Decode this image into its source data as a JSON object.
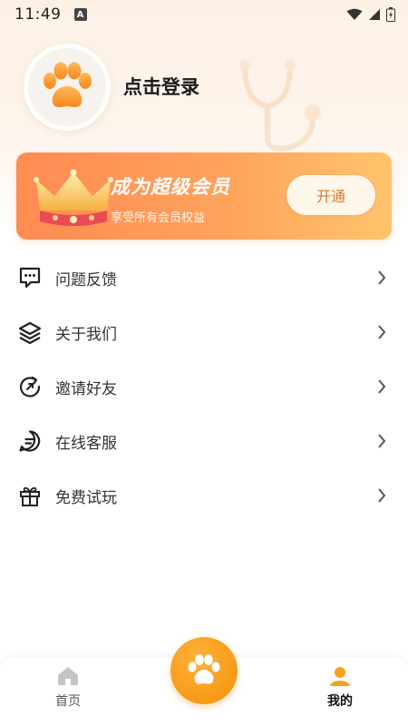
{
  "status_bar": {
    "time": "11:49",
    "notification_badge": "A"
  },
  "profile": {
    "login_prompt": "点击登录",
    "avatar_icon": "paw-icon"
  },
  "vip": {
    "title": "成为超级会员",
    "subtitle": "享受所有会员权益",
    "button_label": "开通",
    "icon": "crown-icon"
  },
  "menu": {
    "items": [
      {
        "label": "问题反馈",
        "icon": "feedback-chat-icon"
      },
      {
        "label": "关于我们",
        "icon": "layers-icon"
      },
      {
        "label": "邀请好友",
        "icon": "refresh-arrow-icon"
      },
      {
        "label": "在线客服",
        "icon": "message-icon"
      },
      {
        "label": "免费试玩",
        "icon": "gift-icon"
      }
    ]
  },
  "tabbar": {
    "home_label": "首页",
    "mine_label": "我的",
    "center_icon": "paw-icon"
  },
  "colors": {
    "accent": "#f79a16",
    "vip_start": "#ff8b52",
    "vip_end": "#ffc46c"
  }
}
